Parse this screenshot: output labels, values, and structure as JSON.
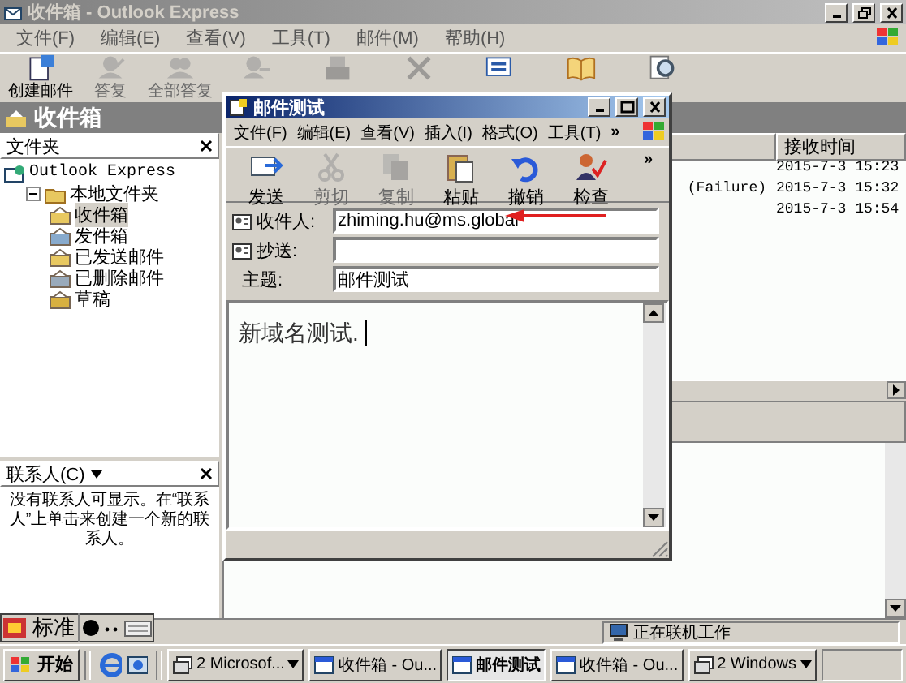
{
  "main_window": {
    "title": "收件箱 - Outlook Express",
    "menu": [
      "文件(F)",
      "编辑(E)",
      "查看(V)",
      "工具(T)",
      "邮件(M)",
      "帮助(H)"
    ],
    "toolbar": [
      {
        "kind": "new",
        "label": "创建邮件",
        "disabled": false
      },
      {
        "kind": "reply",
        "label": "答复",
        "disabled": true
      },
      {
        "kind": "reply_all",
        "label": "全部答复",
        "disabled": true
      },
      {
        "kind": "forward",
        "disabled": true
      },
      {
        "kind": "print",
        "disabled": true
      },
      {
        "kind": "delete",
        "disabled": true
      },
      {
        "kind": "send_receive",
        "disabled": false
      },
      {
        "kind": "address",
        "disabled": false
      },
      {
        "kind": "find",
        "disabled": false
      }
    ],
    "folder_bar": {
      "title": "收件箱"
    },
    "folders": {
      "header": "文件夹",
      "tree": [
        {
          "label": "Outlook Express",
          "selected": false,
          "children": [
            {
              "label": "本地文件夹",
              "selected": false,
              "children": [
                {
                  "label": "收件箱",
                  "kind": "inbox",
                  "selected": true
                },
                {
                  "label": "发件箱",
                  "kind": "outbox",
                  "selected": false
                },
                {
                  "label": "已发送邮件",
                  "kind": "sent",
                  "selected": false
                },
                {
                  "label": "已删除邮件",
                  "kind": "deleted",
                  "selected": false
                },
                {
                  "label": "草稿",
                  "kind": "drafts",
                  "selected": false
                }
              ]
            }
          ]
        }
      ]
    },
    "contacts": {
      "header": "联系人(C)",
      "message": "没有联系人可显示。在“联系人”上单击来创建一个新的联系人。"
    },
    "message_list": {
      "columns": [
        "接收时间"
      ],
      "rows": [
        {
          "received": "2015-7-3 15:23"
        },
        {
          "column_1": "(Failure)",
          "received": "2015-7-3 15:32"
        },
        {
          "received": "2015-7-3 15:54"
        }
      ]
    },
    "status_bar": {
      "text": "正在联机工作"
    },
    "language_bar": {
      "mode": "标准"
    }
  },
  "compose_window": {
    "title": "邮件测试",
    "menu": [
      "文件(F)",
      "编辑(E)",
      "查看(V)",
      "插入(I)",
      "格式(O)",
      "工具(T)"
    ],
    "menu_overflow": "»",
    "toolbar": [
      {
        "kind": "send",
        "label": "发送",
        "disabled": false
      },
      {
        "kind": "cut",
        "label": "剪切",
        "disabled": true
      },
      {
        "kind": "copy",
        "label": "复制",
        "disabled": true
      },
      {
        "kind": "paste",
        "label": "粘贴",
        "disabled": false
      },
      {
        "kind": "undo",
        "label": "撤销",
        "disabled": false
      },
      {
        "kind": "check",
        "label": "检查",
        "disabled": false
      }
    ],
    "toolbar_overflow": "»",
    "fields": [
      {
        "kind": "address",
        "label": "收件人:",
        "value": "zhiming.hu@ms.global"
      },
      {
        "kind": "address",
        "label": "抄送:"
      },
      {
        "kind": "plain",
        "label": "主题:",
        "value": "邮件测试"
      }
    ],
    "body": "新域名测试."
  },
  "taskbar": {
    "start": "开始",
    "tasks": [
      {
        "kind": "group",
        "label": "2 Microsof...",
        "selected": false
      },
      {
        "kind": "window",
        "label": "收件箱 - Ou...",
        "selected": false
      },
      {
        "kind": "window",
        "label": "邮件测试",
        "selected": true
      },
      {
        "kind": "window",
        "label": "收件箱 - Ou...",
        "selected": false
      },
      {
        "kind": "group",
        "label": "2 Windows",
        "selected": false
      }
    ]
  }
}
